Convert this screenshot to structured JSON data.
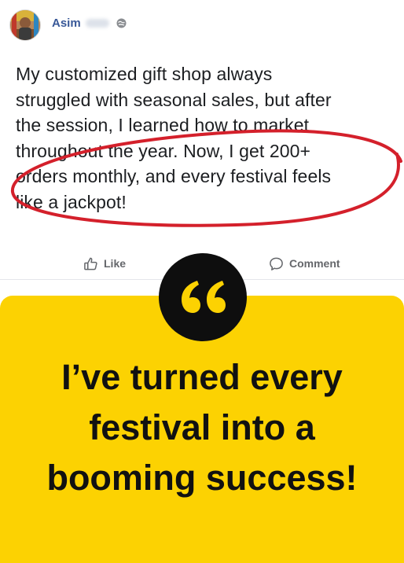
{
  "post": {
    "author_name": "Asim",
    "privacy_icon": "globe-icon",
    "text_lines": [
      "My customized gift shop always",
      "struggled with seasonal sales, but after",
      "the session, I learned how to market",
      "throughout the year. Now, I get 200+",
      "orders monthly, and every festival feels",
      "like a jackpot!"
    ],
    "annotation_color": "#d4202b"
  },
  "actions": {
    "like_label": "Like",
    "like_icon": "thumbs-up-icon",
    "comment_label": "Comment",
    "comment_icon": "speech-bubble-icon"
  },
  "quote_card": {
    "background": "#fcd202",
    "badge_icon": "quote-mark-icon",
    "headline_lines": [
      "I’ve turned every",
      "festival into a",
      "booming success!"
    ]
  }
}
